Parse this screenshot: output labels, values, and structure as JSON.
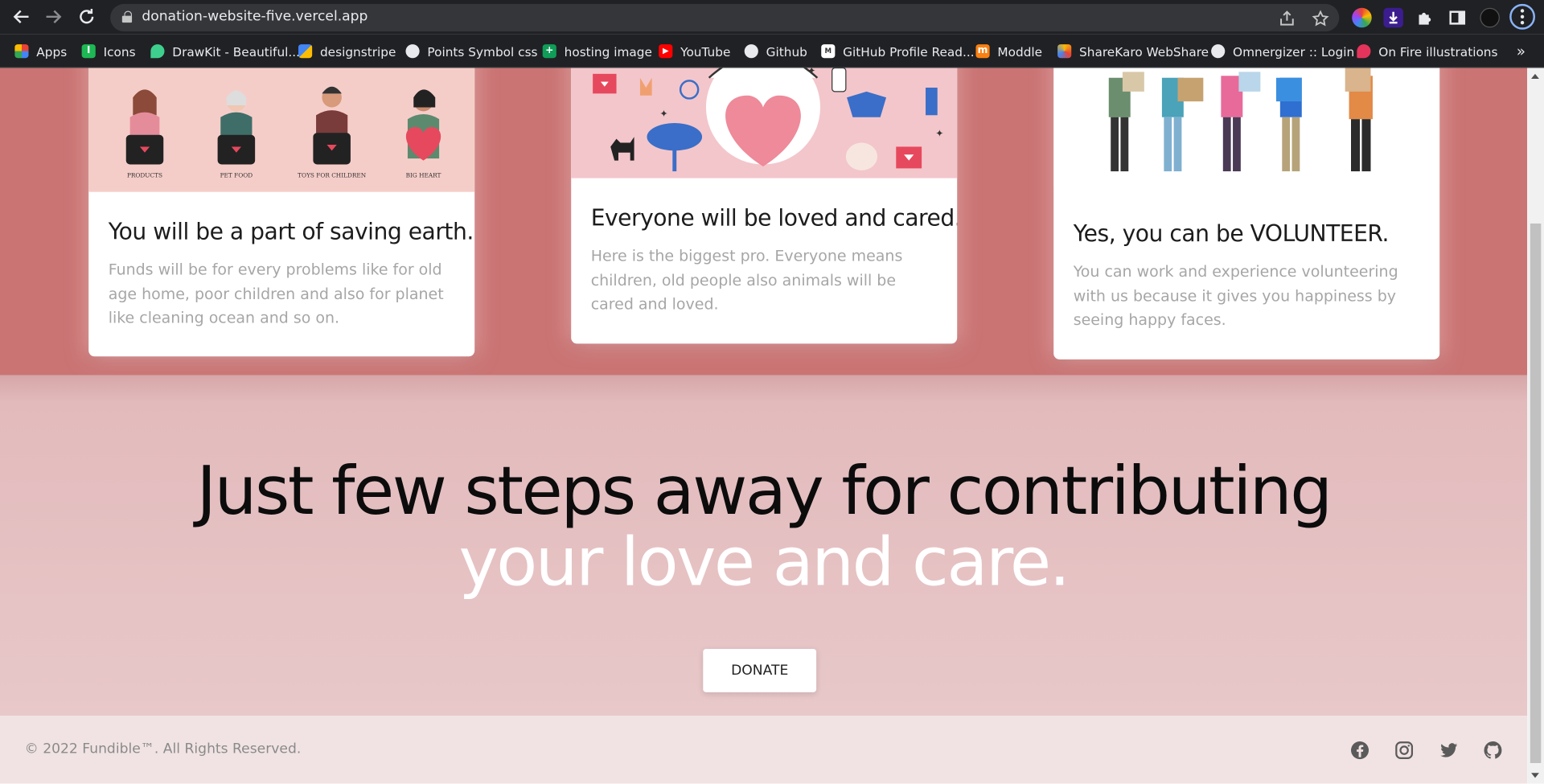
{
  "browser": {
    "url": "donation-website-five.vercel.app",
    "bookmarks": [
      {
        "label": "Apps",
        "icon": "apps-grid-icon"
      },
      {
        "label": "Icons",
        "icon": "icons-icon"
      },
      {
        "label": "DrawKit - Beautiful...",
        "icon": "drawkit-icon"
      },
      {
        "label": "designstripe",
        "icon": "designstripe-icon"
      },
      {
        "label": "Points Symbol css",
        "icon": "globe-icon"
      },
      {
        "label": "hosting image",
        "icon": "plus-icon"
      },
      {
        "label": "YouTube",
        "icon": "youtube-icon"
      },
      {
        "label": "Github",
        "icon": "github-icon"
      },
      {
        "label": "GitHub Profile Read...",
        "icon": "markdown-icon"
      },
      {
        "label": "Moddle",
        "icon": "moodle-icon"
      },
      {
        "label": "ShareKaro WebShare",
        "icon": "sharekaro-icon"
      },
      {
        "label": "Omnergizer :: Login",
        "icon": "globe-icon"
      },
      {
        "label": "On Fire illustrations",
        "icon": "fire-icon"
      }
    ],
    "more": "»"
  },
  "cards": [
    {
      "title": "You will be a part of saving earth.",
      "text": "Funds will be for every problems like for old age home, poor children and also for planet like cleaning ocean and so on.",
      "image_labels": [
        "PRODUCTS",
        "PET FOOD",
        "TOYS FOR CHILDREN",
        "BIG HEART"
      ]
    },
    {
      "title": "Everyone will be loved and cared.",
      "text": "Here is the biggest pro. Everyone means children, old people also animals will be cared and loved."
    },
    {
      "title": "Yes, you can be VOLUNTEER.",
      "text": "You can work and experience volunteering with us because it gives you happiness by seeing happy faces."
    }
  ],
  "cta": {
    "line1": "Just few steps away for contributing",
    "line2": "your love and care.",
    "button": "DONATE"
  },
  "footer": {
    "copyright": "© 2022 Fundible™. All Rights Reserved.",
    "social": [
      "facebook-icon",
      "instagram-icon",
      "twitter-icon",
      "github-icon"
    ]
  },
  "colors": {
    "benefits_bg": "#ca7474",
    "cta_bg": "#e4bfc0",
    "footer_bg": "#f1e3e3",
    "chrome_bg": "#202124"
  }
}
